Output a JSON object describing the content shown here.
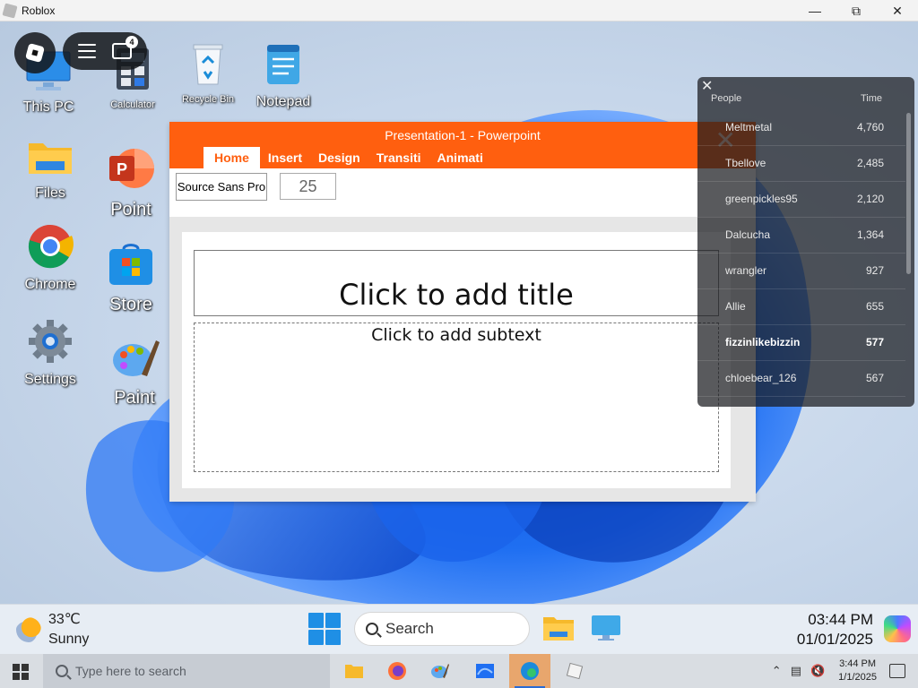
{
  "window": {
    "title": "Roblox",
    "controls": [
      "minimize-icon",
      "maximize-icon",
      "close-icon"
    ]
  },
  "desktop_icons": [
    {
      "label": "This PC",
      "icon": "monitor-icon"
    },
    {
      "label": "Calculator",
      "icon": "calculator-icon"
    },
    {
      "label": "Recycle Bin",
      "icon": "recycle-bin-icon"
    },
    {
      "label": "Notepad",
      "icon": "notepad-icon"
    },
    {
      "label": "Files",
      "icon": "folder-icon"
    },
    {
      "label": "Point",
      "icon": "powerpoint-icon"
    },
    {
      "label": "Chrome",
      "icon": "chrome-icon"
    },
    {
      "label": "Store",
      "icon": "store-icon"
    },
    {
      "label": "Settings",
      "icon": "gear-icon"
    },
    {
      "label": "Paint",
      "icon": "paint-icon"
    }
  ],
  "roblox_overlay": {
    "chat_badge": "4"
  },
  "powerpoint": {
    "title": "Presentation-1 - Powerpoint",
    "tabs": [
      "Home",
      "Insert",
      "Design",
      "Transiti",
      "Animati"
    ],
    "active_tab": "Home",
    "font_name": "Source Sans Pro",
    "font_size": "25",
    "slide": {
      "title_placeholder": "Click to add title",
      "subtext_placeholder": "Click to add subtext"
    }
  },
  "leaderboard": {
    "headers": {
      "people": "People",
      "time": "Time"
    },
    "rows": [
      {
        "name": "Meltmetal",
        "value": "4,760"
      },
      {
        "name": "Tbellove",
        "value": "2,485"
      },
      {
        "name": "greenpickles95",
        "value": "2,120"
      },
      {
        "name": "Dalcucha",
        "value": "1,364"
      },
      {
        "name": "wrangler",
        "value": "927"
      },
      {
        "name": "Allie",
        "value": "655"
      },
      {
        "name": "fizzinlikebizzin",
        "value": "577"
      },
      {
        "name": "chloebear_126",
        "value": "567"
      }
    ]
  },
  "inner_taskbar": {
    "weather_temp": "33℃",
    "weather_cond": "Sunny",
    "search_label": "Search",
    "time": "03:44 PM",
    "date": "01/01/2025"
  },
  "outer_taskbar": {
    "search_placeholder": "Type here to search",
    "time": "3:44 PM",
    "date": "1/1/2025"
  },
  "colors": {
    "ppt_accent": "#ff5f0f",
    "win_blue": "#1f8fe5"
  }
}
